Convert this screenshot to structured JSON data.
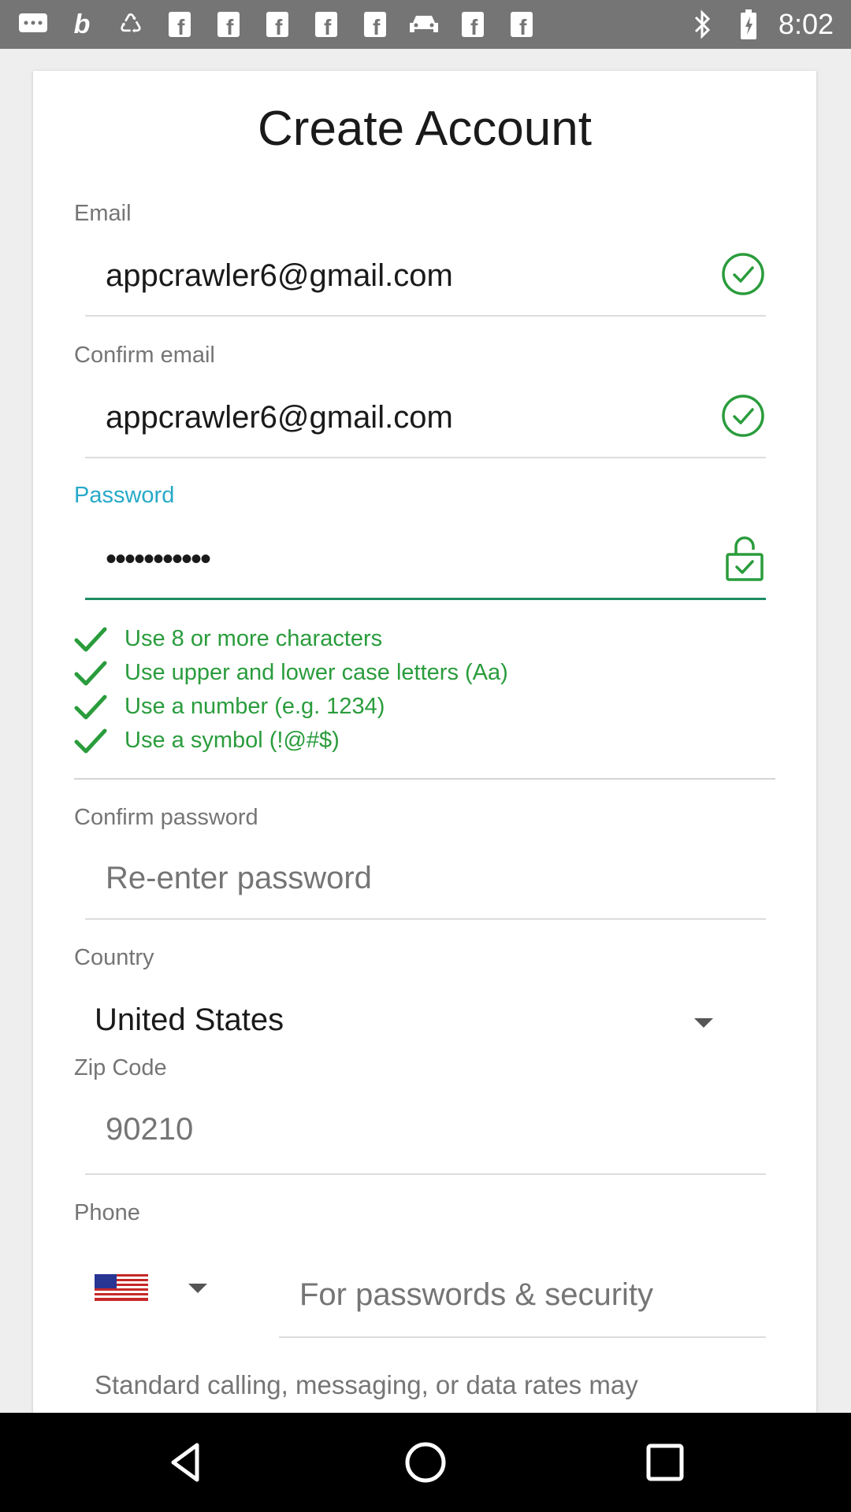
{
  "status_bar": {
    "time": "8:02",
    "left_icons": [
      "chat-icon",
      "b-icon",
      "recycle-icon",
      "facebook-icon",
      "facebook-icon",
      "facebook-icon",
      "facebook-icon",
      "facebook-icon",
      "car-icon",
      "facebook-icon",
      "facebook-icon"
    ],
    "right_icons": [
      "bluetooth-icon",
      "battery-icon"
    ]
  },
  "form": {
    "title": "Create Account",
    "email": {
      "label": "Email",
      "value": "appcrawler6@gmail.com",
      "valid": true
    },
    "confirm_email": {
      "label": "Confirm email",
      "value": "appcrawler6@gmail.com",
      "valid": true
    },
    "password": {
      "label": "Password",
      "value": "•••••••••••",
      "focused": true
    },
    "password_requirements": [
      {
        "text": "Use 8 or more characters",
        "met": true
      },
      {
        "text": "Use upper and lower case letters (Aa)",
        "met": true
      },
      {
        "text": "Use a number (e.g. 1234)",
        "met": true
      },
      {
        "text": "Use a symbol (!@#$)",
        "met": true
      }
    ],
    "confirm_password": {
      "label": "Confirm password",
      "placeholder": "Re-enter password"
    },
    "country": {
      "label": "Country",
      "value": "United States"
    },
    "zip": {
      "label": "Zip Code",
      "placeholder": "90210"
    },
    "phone": {
      "label": "Phone",
      "country_flag": "us-flag-icon",
      "placeholder": "For passwords & security"
    },
    "disclaimer": "Standard calling, messaging, or data rates may"
  },
  "nav_bar": {
    "buttons": [
      "back-icon",
      "home-icon",
      "recents-icon"
    ]
  },
  "colors": {
    "accent": "#26a9c8",
    "valid_green": "#2a9c3c",
    "active_underline": "#1e8c63",
    "status_bar": "#757575"
  }
}
